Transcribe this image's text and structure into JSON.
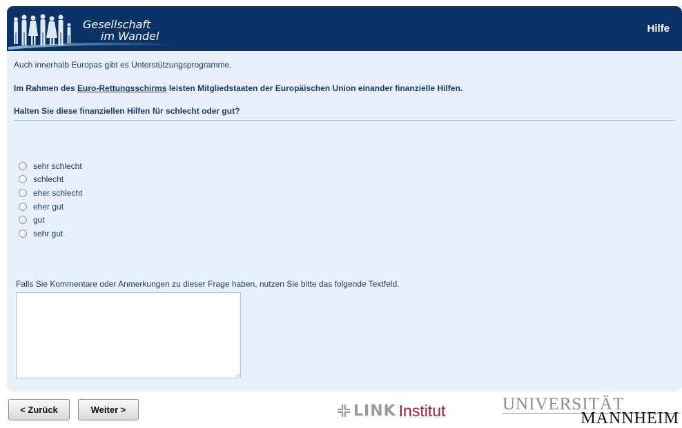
{
  "header": {
    "logo_line1": "Gesellschaft",
    "logo_line2": "im Wandel",
    "help_label": "Hilfe"
  },
  "survey": {
    "intro": "Auch innerhalb Europas gibt es Unterstützungsprogramme.",
    "statement_prefix": "Im Rahmen des ",
    "statement_link": "Euro-Rettungsschirms",
    "statement_suffix": " leisten Mitgliedstaaten der Europäischen Union einander finanzielle Hilfen.",
    "question": "Halten Sie diese finanziellen Hilfen für schlecht oder gut?",
    "options": [
      "sehr schlecht",
      "schlecht",
      "eher schlecht",
      "eher gut",
      "gut",
      "sehr gut"
    ],
    "selected_option": null,
    "comment_label": "Falls Sie Kommentare oder Anmerkungen zu dieser Frage haben, nutzen Sie bitte das folgende Textfeld.",
    "comment_value": ""
  },
  "nav": {
    "back_label": "< Zurück",
    "next_label": "Weiter >"
  },
  "footer": {
    "link_logo_word": "LINK",
    "link_logo_institut": "Institut",
    "uni_line1": "UNIVERSITÄT",
    "uni_line2": "MANNHEIM"
  },
  "colors": {
    "header_bg": "#0b3267",
    "panel_bg": "#e8f1fb",
    "text": "#1b3a6b",
    "link_institut_red": "#a31a2e"
  }
}
